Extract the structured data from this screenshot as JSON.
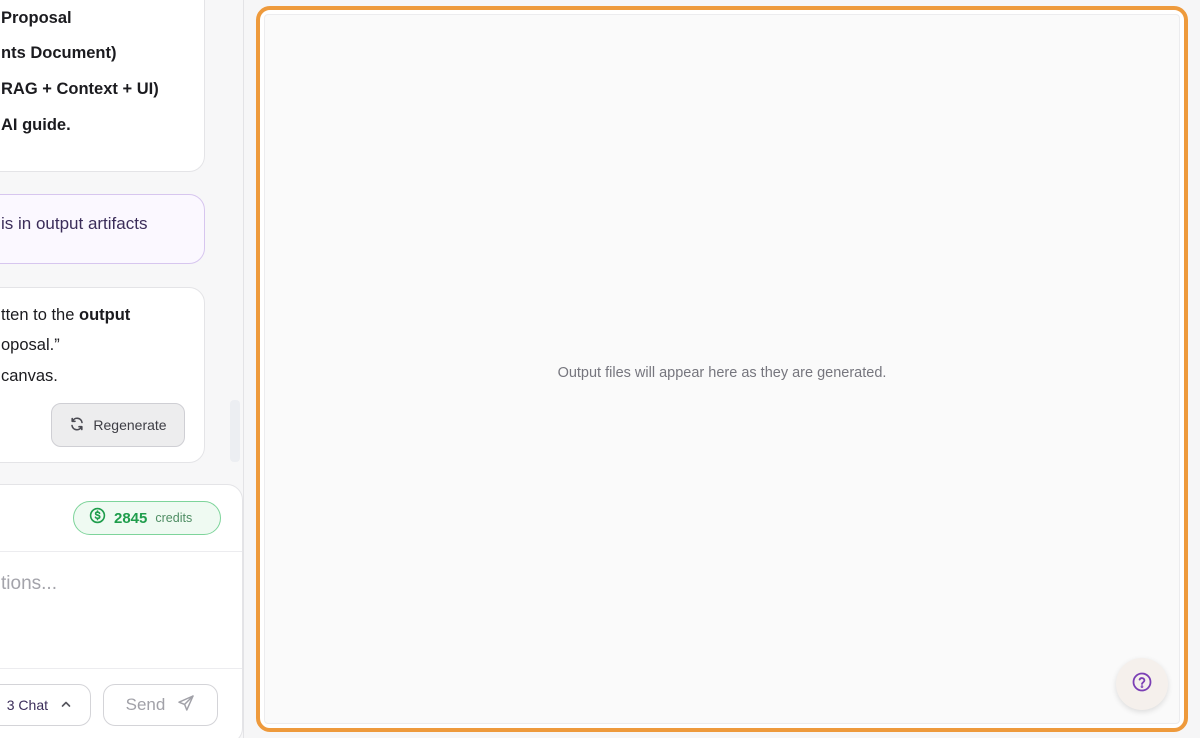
{
  "chat": {
    "message1_lines": [
      "Proposal",
      "nts Document)",
      "RAG + Context + UI)",
      "AI guide."
    ],
    "user_message": "is in output artifacts",
    "message3": {
      "line1_prefix": "tten to the ",
      "line1_bold": "output",
      "line2": "oposal.”",
      "line3": "canvas."
    },
    "regenerate_label": "Regenerate"
  },
  "composer": {
    "credits_value": "2845",
    "credits_label": "credits",
    "placeholder": "tions...",
    "mode_label": "3 Chat",
    "send_label": "Send"
  },
  "output": {
    "empty_message": "Output files will appear here as they are generated."
  },
  "colors": {
    "panel_border": "#ee9a3c",
    "credits_accent": "#1f9d4c",
    "user_bubble_border": "#d7c6ef",
    "help_icon": "#7b3fb5"
  },
  "icons": {
    "regenerate": "refresh-icon",
    "credits": "dollar-circle-icon",
    "mode": "chevron-up-icon",
    "send": "send-icon",
    "help": "question-circle-icon"
  }
}
